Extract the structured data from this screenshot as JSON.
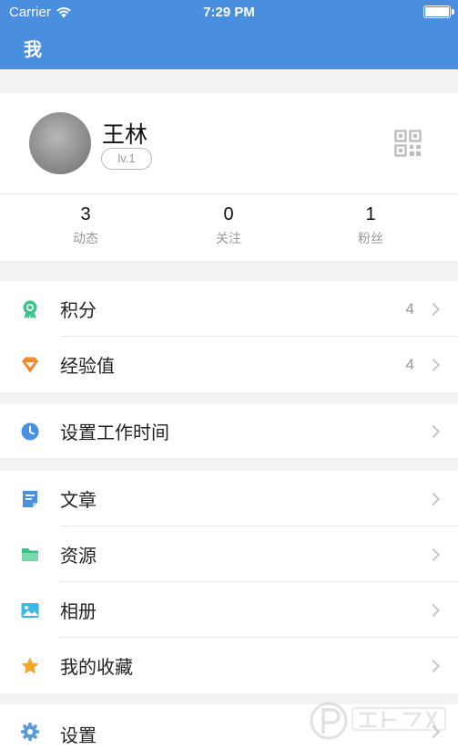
{
  "status_bar": {
    "carrier": "Carrier",
    "time": "7:29 PM"
  },
  "nav": {
    "title": "我"
  },
  "profile": {
    "name": "王林",
    "level": "lv.1",
    "stats": [
      {
        "value": "3",
        "label": "动态"
      },
      {
        "value": "0",
        "label": "关注"
      },
      {
        "value": "1",
        "label": "粉丝"
      }
    ]
  },
  "groups": {
    "points": {
      "label": "积分",
      "value": "4"
    },
    "experience": {
      "label": "经验值",
      "value": "4"
    },
    "work_time": {
      "label": "设置工作时间"
    },
    "articles": {
      "label": "文章"
    },
    "resources": {
      "label": "资源"
    },
    "album": {
      "label": "相册"
    },
    "favorites": {
      "label": "我的收藏"
    },
    "settings": {
      "label": "设置"
    }
  },
  "colors": {
    "nav_bar": "#4a8ee0",
    "points_icon": "#3cc488",
    "experience_icon": "#f08a2c",
    "clock_icon": "#4a90e2",
    "article_icon": "#4a90e2",
    "folder_icon": "#3cc488",
    "album_icon": "#3bb7e8",
    "star_icon": "#f5a623",
    "settings_icon": "#5b9bd5"
  },
  "icons": [
    "wifi-icon",
    "battery-icon",
    "qr-code-icon",
    "medal-icon",
    "diamond-icon",
    "clock-icon",
    "document-icon",
    "folder-icon",
    "image-icon",
    "star-icon",
    "gear-icon",
    "chevron-right-icon"
  ]
}
